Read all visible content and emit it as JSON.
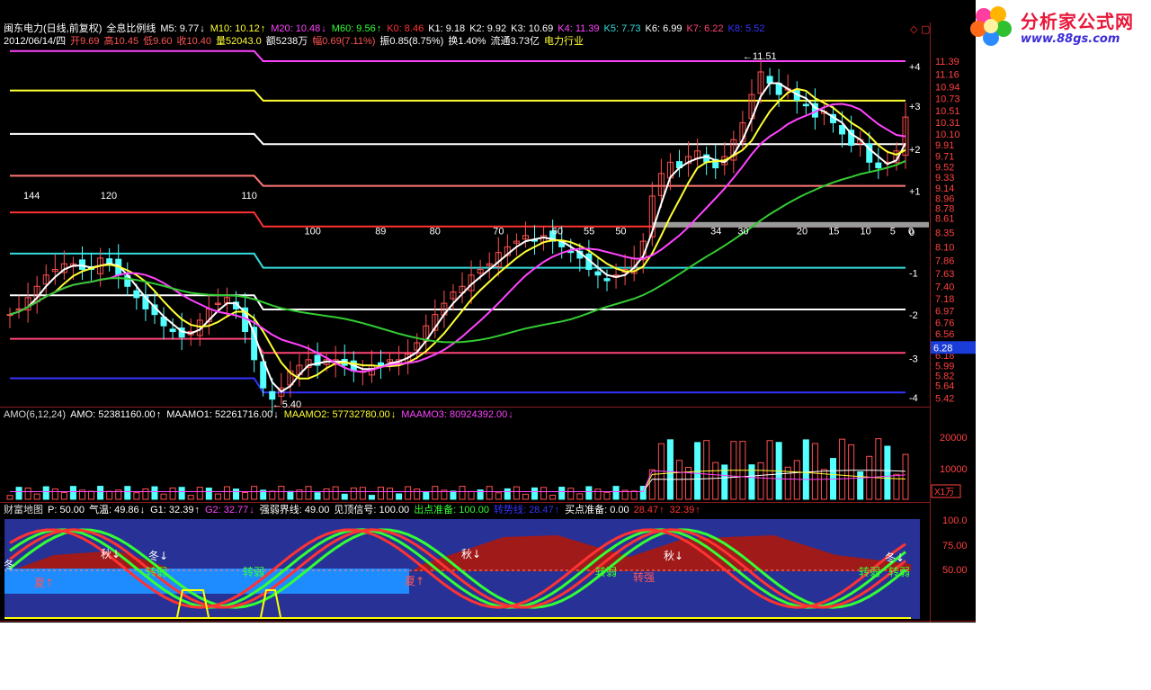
{
  "header": {
    "stock": "闽东电力(日线,前复权)",
    "indicator": "全息比例线",
    "ma_items": [
      {
        "label": "M5: 9.77",
        "arrow": "↓",
        "color": "#ffffff"
      },
      {
        "label": "M10: 10.12",
        "arrow": "↑",
        "color": "#ffff33"
      },
      {
        "label": "M20: 10.48",
        "arrow": "↓",
        "color": "#ff44ff"
      },
      {
        "label": "M60: 9.56",
        "arrow": "↑",
        "color": "#33ff33"
      },
      {
        "label": "K0: 8.46",
        "arrow": "",
        "color": "#ff3333"
      },
      {
        "label": "K1: 9.18",
        "arrow": "",
        "color": "#ffffff"
      },
      {
        "label": "K2: 9.92",
        "arrow": "",
        "color": "#ffffff"
      },
      {
        "label": "K3: 10.69",
        "arrow": "",
        "color": "#ffffff"
      },
      {
        "label": "K4: 11.39",
        "arrow": "",
        "color": "#ff44ff"
      },
      {
        "label": "K5: 7.73",
        "arrow": "",
        "color": "#33dddd"
      },
      {
        "label": "K6: 6.99",
        "arrow": "",
        "color": "#ffffff"
      },
      {
        "label": "K7: 6.22",
        "arrow": "",
        "color": "#ff4477"
      },
      {
        "label": "K8: 5.52",
        "arrow": "",
        "color": "#3333ff"
      }
    ],
    "quote_items": [
      {
        "label": "2012/06/14/四",
        "color": "#ffffff"
      },
      {
        "label": "开9.69",
        "color": "#ff5555"
      },
      {
        "label": "高10.45",
        "color": "#ff5555"
      },
      {
        "label": "低9.60",
        "color": "#ff5555"
      },
      {
        "label": "收10.40",
        "color": "#ff5555"
      },
      {
        "label": "量52043.0",
        "color": "#ffff33"
      },
      {
        "label": "额5238万",
        "color": "#ffffff"
      },
      {
        "label": "幅0.69(7.11%)",
        "color": "#ff5555"
      },
      {
        "label": "振0.85(8.75%)",
        "color": "#ffffff"
      },
      {
        "label": "换1.40%",
        "color": "#ffffff"
      },
      {
        "label": "流通3.73亿",
        "color": "#ffffff"
      },
      {
        "label": "电力行业",
        "color": "#ffff33"
      }
    ]
  },
  "watermark": {
    "title": "分析家公式网",
    "url": "www.88gs.com"
  },
  "price_axis": [
    "11.39",
    "11.16",
    "10.94",
    "10.73",
    "10.51",
    "10.31",
    "10.10",
    "9.91",
    "9.71",
    "9.52",
    "9.33",
    "9.14",
    "8.96",
    "8.78",
    "8.61",
    "8.35",
    "8.10",
    "7.86",
    "7.63",
    "7.40",
    "7.18",
    "6.97",
    "6.76",
    "6.56",
    "6.37",
    "6.18",
    "5.99",
    "5.82",
    "5.64",
    "5.42"
  ],
  "current_price_tag": "6.28",
  "level_labels": [
    "+4",
    "+3",
    "+2",
    "+1",
    "0",
    "-1",
    "-2",
    "-3",
    "-4"
  ],
  "countdown_labels": [
    "144",
    "120",
    "110",
    "100",
    "89",
    "80",
    "70",
    "60",
    "55",
    "50",
    "34",
    "30",
    "20",
    "15",
    "10",
    "5",
    "0"
  ],
  "extremes": {
    "high_label": "11.51",
    "low_label": "5.40"
  },
  "amo_panel": {
    "items": [
      {
        "label": "AMO(6,12,24)",
        "color": "#dddddd"
      },
      {
        "label": "AMO: 52381160.00",
        "arrow": "↑",
        "color": "#ffffff"
      },
      {
        "label": "MAAMO1: 52261716.00",
        "arrow": "↓",
        "color": "#ffffff"
      },
      {
        "label": "MAAMO2: 57732780.00",
        "arrow": "↓",
        "color": "#ffff33"
      },
      {
        "label": "MAAMO3: 80924392.00",
        "arrow": "↓",
        "color": "#ff44ff"
      }
    ],
    "axis": [
      "20000",
      "10000"
    ],
    "unit": "X1万"
  },
  "cf_panel": {
    "items": [
      {
        "label": "财富地图",
        "color": "#dddddd"
      },
      {
        "label": "P: 50.00",
        "color": "#ffffff"
      },
      {
        "label": "气温: 49.86",
        "arrow": "↓",
        "color": "#ffffff"
      },
      {
        "label": "G1: 32.39",
        "arrow": "↑",
        "color": "#ffffff"
      },
      {
        "label": "G2: 32.77",
        "arrow": "↓",
        "color": "#ff44ff"
      },
      {
        "label": "强弱界线: 49.00",
        "color": "#ffffff"
      },
      {
        "label": "见顶信号: 100.00",
        "color": "#ffffff"
      },
      {
        "label": "出点准备: 100.00",
        "color": "#33ff33"
      },
      {
        "label": "转势线: 28.47",
        "arrow": "↑",
        "color": "#3333ff"
      },
      {
        "label": "买点准备: 0.00",
        "color": "#ffffff"
      },
      {
        "label": "28.47",
        "arrow": "↑",
        "color": "#ff3333"
      },
      {
        "label": "32.39",
        "arrow": "↑",
        "color": "#ff3333"
      }
    ],
    "axis": [
      "100.0",
      "75.00",
      "50.00"
    ],
    "season_labels": [
      {
        "text": "冬",
        "color": "#ffffff"
      },
      {
        "text": "夏↑",
        "color": "#ff5555"
      },
      {
        "text": "秋↓",
        "color": "#ffffff"
      },
      {
        "text": "冬↓",
        "color": "#ffffff"
      },
      {
        "text": "转弱",
        "color": "#33ff33"
      },
      {
        "text": "转弱",
        "color": "#33ff33"
      },
      {
        "text": "夏↑",
        "color": "#ff5555"
      },
      {
        "text": "秋↓",
        "color": "#ffffff"
      },
      {
        "text": "转弱",
        "color": "#33ff33"
      },
      {
        "text": "转强",
        "color": "#ff5555"
      },
      {
        "text": "秋↓",
        "color": "#ffffff"
      },
      {
        "text": "冬↓",
        "color": "#ffffff"
      },
      {
        "text": "转弱",
        "color": "#33ff33"
      },
      {
        "text": "转弱",
        "color": "#33ff33"
      }
    ]
  },
  "chart_data": {
    "type": "line",
    "title": "闽东电力(日线,前复权)",
    "bars": 170,
    "levels": [
      {
        "name": "K4",
        "value": 11.39,
        "color": "#ff44ff"
      },
      {
        "name": "K3",
        "value": 10.69,
        "color": "#ffff33"
      },
      {
        "name": "K2",
        "value": 9.92,
        "color": "#ffffff"
      },
      {
        "name": "K1",
        "value": 9.18,
        "color": "#ff7777"
      },
      {
        "name": "K0",
        "value": 8.46,
        "color": "#ff3333"
      },
      {
        "name": "K5",
        "value": 7.73,
        "color": "#33dddd"
      },
      {
        "name": "K6",
        "value": 6.99,
        "color": "#ffffff"
      },
      {
        "name": "K7",
        "value": 6.22,
        "color": "#ff4477"
      },
      {
        "name": "K8",
        "value": 5.52,
        "color": "#3333ff"
      }
    ],
    "close_path": [
      6.9,
      7.0,
      7.2,
      7.4,
      7.6,
      7.7,
      7.8,
      7.8,
      7.7,
      7.7,
      7.9,
      7.8,
      7.6,
      7.4,
      7.2,
      7.0,
      6.9,
      6.7,
      6.6,
      6.5,
      6.6,
      6.8,
      7.0,
      7.1,
      7.2,
      7.0,
      6.6,
      6.1,
      5.6,
      5.4,
      5.6,
      5.9,
      6.0,
      6.1,
      6.0,
      6.1,
      6.1,
      6.0,
      5.9,
      5.9,
      6.0,
      6.0,
      6.1,
      6.1,
      6.2,
      6.4,
      6.7,
      6.9,
      7.1,
      7.3,
      7.4,
      7.6,
      7.7,
      7.8,
      8.0,
      8.1,
      8.2,
      8.3,
      8.2,
      8.3,
      8.2,
      8.1,
      8.0,
      7.9,
      7.7,
      7.6,
      7.5,
      7.6,
      7.7,
      7.9,
      8.2,
      9.0,
      9.4,
      9.6,
      9.5,
      9.7,
      9.8,
      9.6,
      9.5,
      9.7,
      10.0,
      10.3,
      10.8,
      11.2,
      11.0,
      10.8,
      10.9,
      10.7,
      10.6,
      10.4,
      10.5,
      10.3,
      10.1,
      9.9,
      10.0,
      9.6,
      9.5,
      9.6,
      9.8,
      10.4
    ]
  }
}
